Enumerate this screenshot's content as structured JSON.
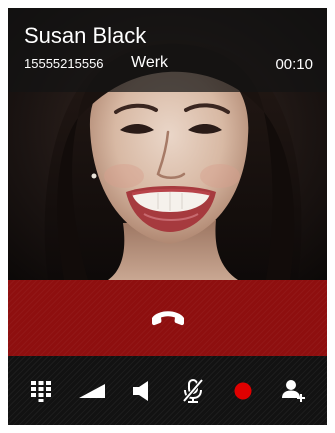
{
  "call": {
    "caller_name": "Susan Black",
    "caller_number": "15555215556",
    "caller_label": "Werk",
    "duration": "00:10"
  },
  "colors": {
    "end_call_bg": "#8e0f0f",
    "toolbar_bg": "#121212",
    "record_dot": "#e00000",
    "icon_fill": "#ffffff"
  },
  "end_call": {
    "icon": "hang-up-icon"
  },
  "toolbar": {
    "items": [
      {
        "name": "dialpad-button",
        "icon": "dialpad-icon"
      },
      {
        "name": "volume-button",
        "icon": "volume-level-icon"
      },
      {
        "name": "speaker-button",
        "icon": "speaker-icon"
      },
      {
        "name": "mute-button",
        "icon": "mic-muted-icon"
      },
      {
        "name": "record-button",
        "icon": "record-icon"
      },
      {
        "name": "add-contact-button",
        "icon": "add-person-icon"
      }
    ]
  }
}
